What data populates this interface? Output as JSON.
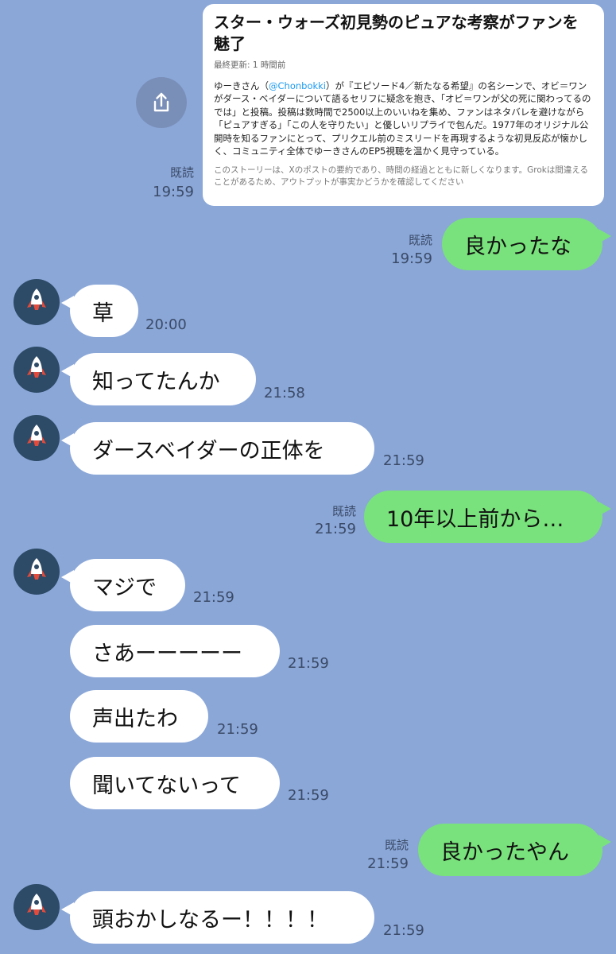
{
  "card": {
    "title": "スター・ウォーズ初見勢のピュアな考察がファンを魅了",
    "meta": "最終更新: 1 時間前",
    "body_pre": "ゆーきさん（",
    "handle": "@Chonbokki",
    "body_post": "）が『エピソード4／新たなる希望』の名シーンで、オビ＝ワンがダース・ベイダーについて語るセリフに疑念を抱き、「オビ＝ワンが父の死に関わってるのでは」と投稿。投稿は数時間で2500以上のいいねを集め、ファンはネタバレを避けながら「ピュアすぎる」「この人を守りたい」と優しいリプライで包んだ。1977年のオリジナル公開時を知るファンにとって、プリクエル前のミスリードを再現するような初見反応が懐かしく、コミュニティ全体でゆーきさんのEP5視聴を温かく見守っている。",
    "footer": "このストーリーは、Xのポストの要約であり、時間の経過とともに新しくなります。Grokは間違えることがあるため、アウトプットが事実かどうかを確認してください",
    "read": "既読",
    "time": "19:59"
  },
  "messages": [
    {
      "side": "right",
      "text": "良かったな",
      "read": "既読",
      "time": "19:59"
    },
    {
      "side": "left",
      "text": "草",
      "time": "20:00"
    },
    {
      "side": "left",
      "text": "知ってたんか",
      "time": "21:58"
    },
    {
      "side": "left",
      "text": "ダースベイダーの正体を",
      "time": "21:59"
    },
    {
      "side": "right",
      "text": "10年以上前から…",
      "read": "既読",
      "time": "21:59"
    },
    {
      "side": "left",
      "text": "マジで",
      "time": "21:59"
    },
    {
      "side": "left",
      "text": "さあーーーーー",
      "time": "21:59"
    },
    {
      "side": "left",
      "text": "声出たわ",
      "time": "21:59"
    },
    {
      "side": "left",
      "text": "聞いてないって",
      "time": "21:59"
    },
    {
      "side": "right",
      "text": "良かったやん",
      "read": "既読",
      "time": "21:59"
    },
    {
      "side": "left",
      "text": "頭おかしなるー！！！！",
      "time": "21:59"
    }
  ],
  "colors": {
    "background": "#8aa7d8",
    "outgoing_bubble": "#79e27c",
    "incoming_bubble": "#ffffff",
    "avatar_bg": "#2d4a66"
  },
  "icons": {
    "share": "share-icon",
    "avatar": "rocket-icon"
  }
}
